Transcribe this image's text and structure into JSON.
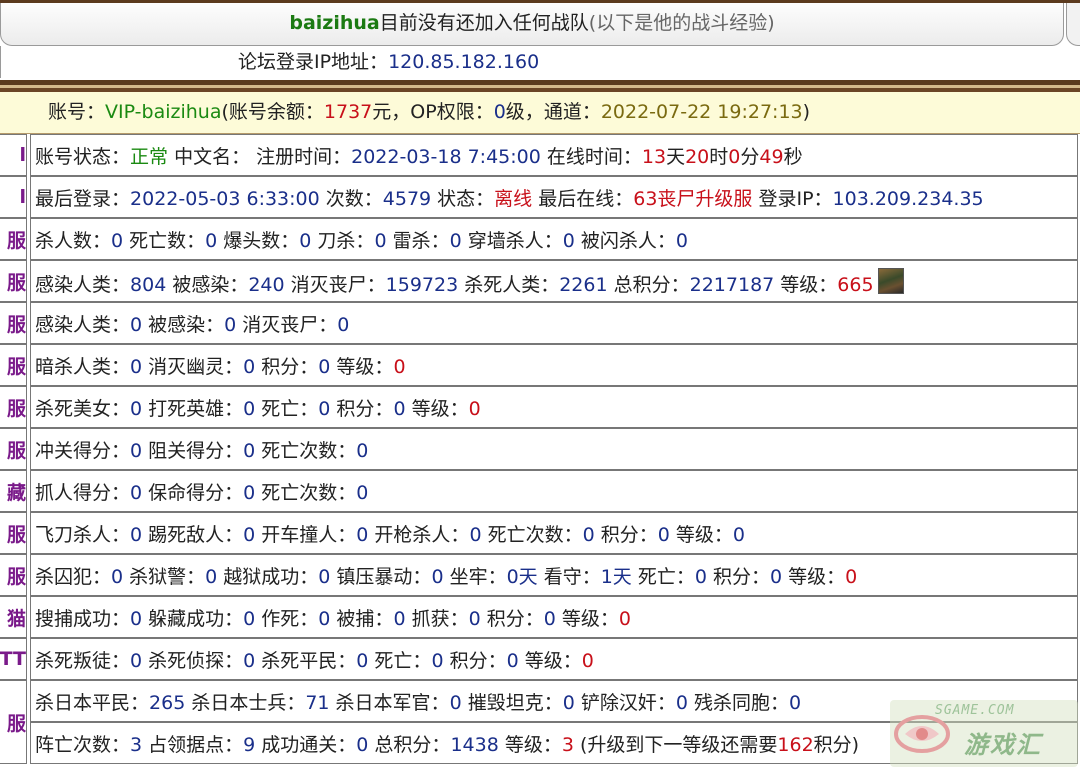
{
  "header": {
    "player_name": "baizihua",
    "status_text": "目前没有还加入任何战队",
    "note": "(以下是他的战斗经验)"
  },
  "forum_ip": {
    "label": "论坛登录IP地址：",
    "value": "120.85.182.160"
  },
  "account": {
    "label": "账号：",
    "name": "VIP-baizihua",
    "balance_label": "(账号余额：",
    "balance": "1737",
    "balance_unit": "元，",
    "op_label": "OP权限：",
    "op": "0",
    "op_unit": "级，",
    "channel_label": "通道：",
    "channel": "2022-07-22 19:27:13",
    "close": ")"
  },
  "left_labels": [
    "l",
    "l",
    "服",
    "服",
    "服",
    "服",
    "服",
    "服",
    "藏",
    "服",
    "服",
    "猫",
    "TT",
    "服"
  ],
  "rows": [
    [
      [
        "账号状态：",
        "k"
      ],
      [
        "正常",
        "g"
      ],
      [
        " 中文名： 注册时间：",
        "k"
      ],
      [
        "2022-03-18 7:45:00",
        "b"
      ],
      [
        " 在线时间：",
        "k"
      ],
      [
        "13",
        "r"
      ],
      [
        "天",
        "k"
      ],
      [
        "20",
        "r"
      ],
      [
        "时",
        "k"
      ],
      [
        "0",
        "r"
      ],
      [
        "分",
        "k"
      ],
      [
        "49",
        "r"
      ],
      [
        "秒",
        "k"
      ]
    ],
    [
      [
        "最后登录：",
        "k"
      ],
      [
        "2022-05-03 6:33:00",
        "b"
      ],
      [
        " 次数：",
        "k"
      ],
      [
        "4579",
        "b"
      ],
      [
        " 状态：",
        "k"
      ],
      [
        "离线",
        "r"
      ],
      [
        " 最后在线：",
        "k"
      ],
      [
        "63丧尸升级服",
        "r"
      ],
      [
        " 登录IP：",
        "k"
      ],
      [
        "103.209.234.35",
        "b"
      ]
    ],
    [
      [
        "杀人数：",
        "k"
      ],
      [
        "0",
        "b"
      ],
      [
        " 死亡数：",
        "k"
      ],
      [
        "0",
        "b"
      ],
      [
        " 爆头数：",
        "k"
      ],
      [
        "0",
        "b"
      ],
      [
        " 刀杀：",
        "k"
      ],
      [
        "0",
        "b"
      ],
      [
        " 雷杀：",
        "k"
      ],
      [
        "0",
        "b"
      ],
      [
        " 穿墙杀人：",
        "k"
      ],
      [
        "0",
        "b"
      ],
      [
        " 被闪杀人：",
        "k"
      ],
      [
        "0",
        "b"
      ]
    ],
    [
      [
        "感染人类：",
        "k"
      ],
      [
        "804",
        "b"
      ],
      [
        " 被感染：",
        "k"
      ],
      [
        "240",
        "b"
      ],
      [
        " 消灭丧尸：",
        "k"
      ],
      [
        "159723",
        "b"
      ],
      [
        " 杀死人类：",
        "k"
      ],
      [
        "2261",
        "b"
      ],
      [
        " 总积分：",
        "k"
      ],
      [
        "2217187",
        "b"
      ],
      [
        " 等级：",
        "k"
      ],
      [
        "665",
        "r"
      ]
    ],
    [
      [
        "感染人类：",
        "k"
      ],
      [
        "0",
        "b"
      ],
      [
        " 被感染：",
        "k"
      ],
      [
        "0",
        "b"
      ],
      [
        " 消灭丧尸：",
        "k"
      ],
      [
        "0",
        "b"
      ]
    ],
    [
      [
        "暗杀人类：",
        "k"
      ],
      [
        "0",
        "b"
      ],
      [
        " 消灭幽灵：",
        "k"
      ],
      [
        "0",
        "b"
      ],
      [
        " 积分：",
        "k"
      ],
      [
        "0",
        "b"
      ],
      [
        " 等级：",
        "k"
      ],
      [
        "0",
        "r"
      ]
    ],
    [
      [
        "杀死美女：",
        "k"
      ],
      [
        "0",
        "b"
      ],
      [
        " 打死英雄：",
        "k"
      ],
      [
        "0",
        "b"
      ],
      [
        " 死亡：",
        "k"
      ],
      [
        "0",
        "b"
      ],
      [
        " 积分：",
        "k"
      ],
      [
        "0",
        "b"
      ],
      [
        " 等级：",
        "k"
      ],
      [
        "0",
        "r"
      ]
    ],
    [
      [
        "冲关得分：",
        "k"
      ],
      [
        "0",
        "b"
      ],
      [
        " 阻关得分：",
        "k"
      ],
      [
        "0",
        "b"
      ],
      [
        " 死亡次数：",
        "k"
      ],
      [
        "0",
        "b"
      ]
    ],
    [
      [
        "抓人得分：",
        "k"
      ],
      [
        "0",
        "b"
      ],
      [
        " 保命得分：",
        "k"
      ],
      [
        "0",
        "b"
      ],
      [
        " 死亡次数：",
        "k"
      ],
      [
        "0",
        "b"
      ]
    ],
    [
      [
        "飞刀杀人：",
        "k"
      ],
      [
        "0",
        "b"
      ],
      [
        " 踢死敌人：",
        "k"
      ],
      [
        "0",
        "b"
      ],
      [
        " 开车撞人：",
        "k"
      ],
      [
        "0",
        "b"
      ],
      [
        " 开枪杀人：",
        "k"
      ],
      [
        "0",
        "b"
      ],
      [
        " 死亡次数：",
        "k"
      ],
      [
        "0",
        "b"
      ],
      [
        " 积分：",
        "k"
      ],
      [
        "0",
        "b"
      ],
      [
        " 等级：",
        "k"
      ],
      [
        "0",
        "b"
      ]
    ],
    [
      [
        "杀囚犯：",
        "k"
      ],
      [
        "0",
        "b"
      ],
      [
        " 杀狱警：",
        "k"
      ],
      [
        "0",
        "b"
      ],
      [
        " 越狱成功：",
        "k"
      ],
      [
        "0",
        "b"
      ],
      [
        " 镇压暴动：",
        "k"
      ],
      [
        "0",
        "b"
      ],
      [
        " 坐牢：",
        "k"
      ],
      [
        "0天",
        "b"
      ],
      [
        " 看守：",
        "k"
      ],
      [
        "1天",
        "b"
      ],
      [
        " 死亡：",
        "k"
      ],
      [
        "0",
        "b"
      ],
      [
        " 积分：",
        "k"
      ],
      [
        "0",
        "b"
      ],
      [
        " 等级：",
        "k"
      ],
      [
        "0",
        "r"
      ]
    ],
    [
      [
        "搜捕成功：",
        "k"
      ],
      [
        "0",
        "b"
      ],
      [
        " 躲藏成功：",
        "k"
      ],
      [
        "0",
        "b"
      ],
      [
        " 作死：",
        "k"
      ],
      [
        "0",
        "b"
      ],
      [
        " 被捕：",
        "k"
      ],
      [
        "0",
        "b"
      ],
      [
        " 抓获：",
        "k"
      ],
      [
        "0",
        "b"
      ],
      [
        " 积分：",
        "k"
      ],
      [
        "0",
        "b"
      ],
      [
        " 等级：",
        "k"
      ],
      [
        "0",
        "r"
      ]
    ],
    [
      [
        "杀死叛徒：",
        "k"
      ],
      [
        "0",
        "b"
      ],
      [
        " 杀死侦探：",
        "k"
      ],
      [
        "0",
        "b"
      ],
      [
        " 杀死平民：",
        "k"
      ],
      [
        "0",
        "b"
      ],
      [
        " 死亡：",
        "k"
      ],
      [
        "0",
        "b"
      ],
      [
        " 积分：",
        "k"
      ],
      [
        "0",
        "b"
      ],
      [
        " 等级：",
        "k"
      ],
      [
        "0",
        "r"
      ]
    ],
    [
      [
        "杀日本平民：",
        "k"
      ],
      [
        "265",
        "b"
      ],
      [
        " 杀日本士兵：",
        "k"
      ],
      [
        "71",
        "b"
      ],
      [
        " 杀日本军官：",
        "k"
      ],
      [
        "0",
        "b"
      ],
      [
        " 摧毁坦克：",
        "k"
      ],
      [
        "0",
        "b"
      ],
      [
        " 铲除汉奸：",
        "k"
      ],
      [
        "0",
        "b"
      ],
      [
        " 残杀同胞：",
        "k"
      ],
      [
        "0",
        "b"
      ]
    ],
    [
      [
        "阵亡次数：",
        "k"
      ],
      [
        "3",
        "b"
      ],
      [
        " 占领据点：",
        "k"
      ],
      [
        "9",
        "b"
      ],
      [
        " 成功通关：",
        "k"
      ],
      [
        "0",
        "b"
      ],
      [
        " 总积分：",
        "k"
      ],
      [
        "1438",
        "b"
      ],
      [
        " 等级：",
        "k"
      ],
      [
        "3",
        "r"
      ],
      [
        " (升级到下一等级还需要",
        "k"
      ],
      [
        "162",
        "r"
      ],
      [
        "积分)",
        "k"
      ]
    ]
  ],
  "watermark": {
    "site": "SGAME.COM",
    "brand": "游戏汇"
  },
  "colors": {
    "label": "#222222",
    "number": "#1a2f8a",
    "highlight": "#c8101a",
    "ok": "#1b8a12",
    "player": "#1b7a12",
    "accent_bar": "#5b3a1e"
  },
  "icons": {
    "level_avatar": "level-avatar-icon"
  }
}
